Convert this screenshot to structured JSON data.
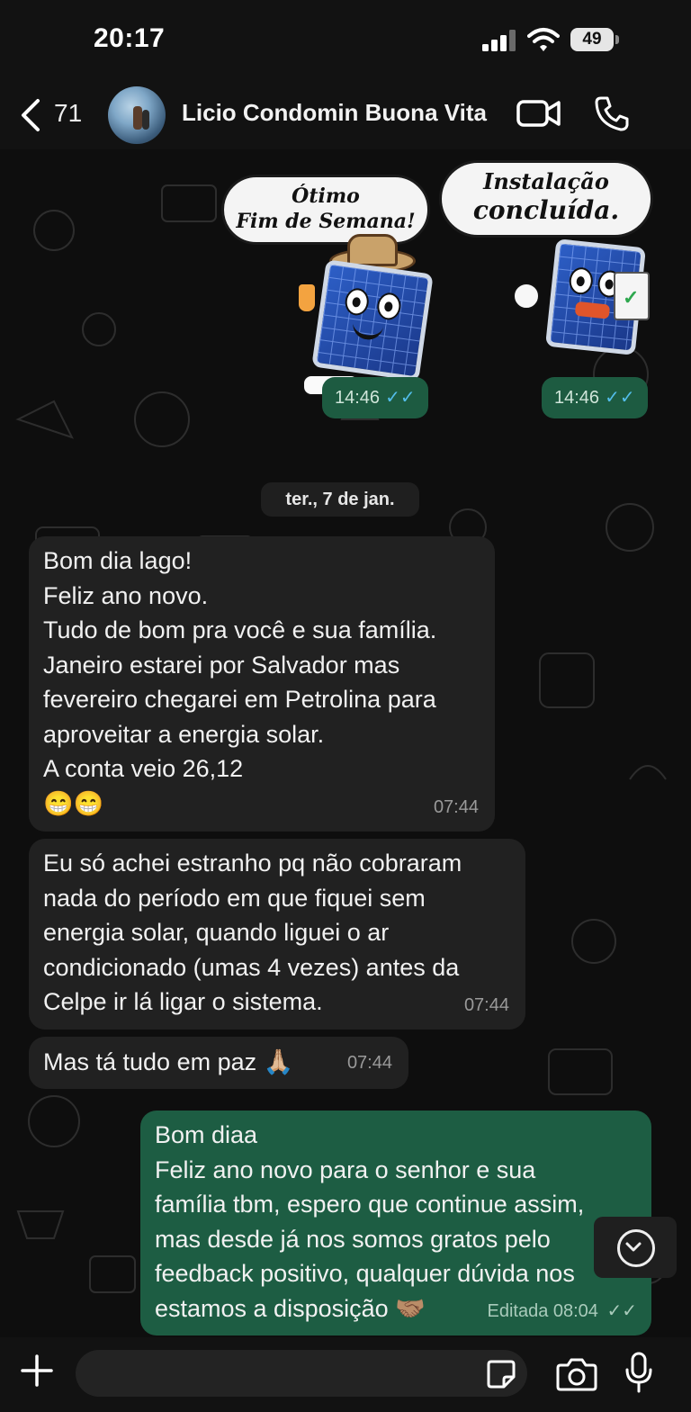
{
  "status_bar": {
    "time": "20:17",
    "battery": "49"
  },
  "header": {
    "back_count": "71",
    "contact_name": "Licio Condomin Buona Vita"
  },
  "stickers": [
    {
      "caption_line1": "Ótimo",
      "caption_line2": "Fim de Semana!",
      "time": "14:46"
    },
    {
      "caption_line1": "Instalação",
      "caption_line2": "concluída.",
      "time": "14:46"
    }
  ],
  "date_separator": "ter., 7 de jan.",
  "messages": [
    {
      "direction": "in",
      "text": "Bom dia lago!\nFeliz ano novo.\nTudo de bom pra você e sua família.\nJaneiro estarei por Salvador mas\nfevereiro chegarei em Petrolina para\naproveitar a energia solar.\nA conta veio 26,12\n😁😁",
      "time": "07:44"
    },
    {
      "direction": "in",
      "text": "Eu só achei estranho pq não cobraram\nnada do período em que fiquei sem\nenergia solar, quando liguei o ar\ncondicionado (umas 4 vezes) antes da\nCelpe ir lá ligar o sistema.",
      "time": "07:44"
    },
    {
      "direction": "in",
      "text": "Mas tá tudo em paz 🙏🏼",
      "time": "07:44"
    },
    {
      "direction": "out",
      "text": "Bom diaa\nFeliz ano novo para o senhor e sua\nfamília tbm, espero que continue assim,\nmas desde já nos somos gratos pelo\nfeedback positivo, qualquer dúvida nos\nestamos a disposição 🤝🏽",
      "time": "Editada 08:04",
      "ticks": "✓✓"
    }
  ],
  "icons": [
    "chevron-left-icon",
    "video-icon",
    "phone-icon",
    "plus-icon",
    "sticker-icon",
    "camera-icon",
    "mic-icon",
    "chevron-down-icon"
  ],
  "colors": {
    "outgoing_bubble": "#1d5d43",
    "incoming_bubble": "#212121",
    "read_ticks": "#53bdeb"
  }
}
